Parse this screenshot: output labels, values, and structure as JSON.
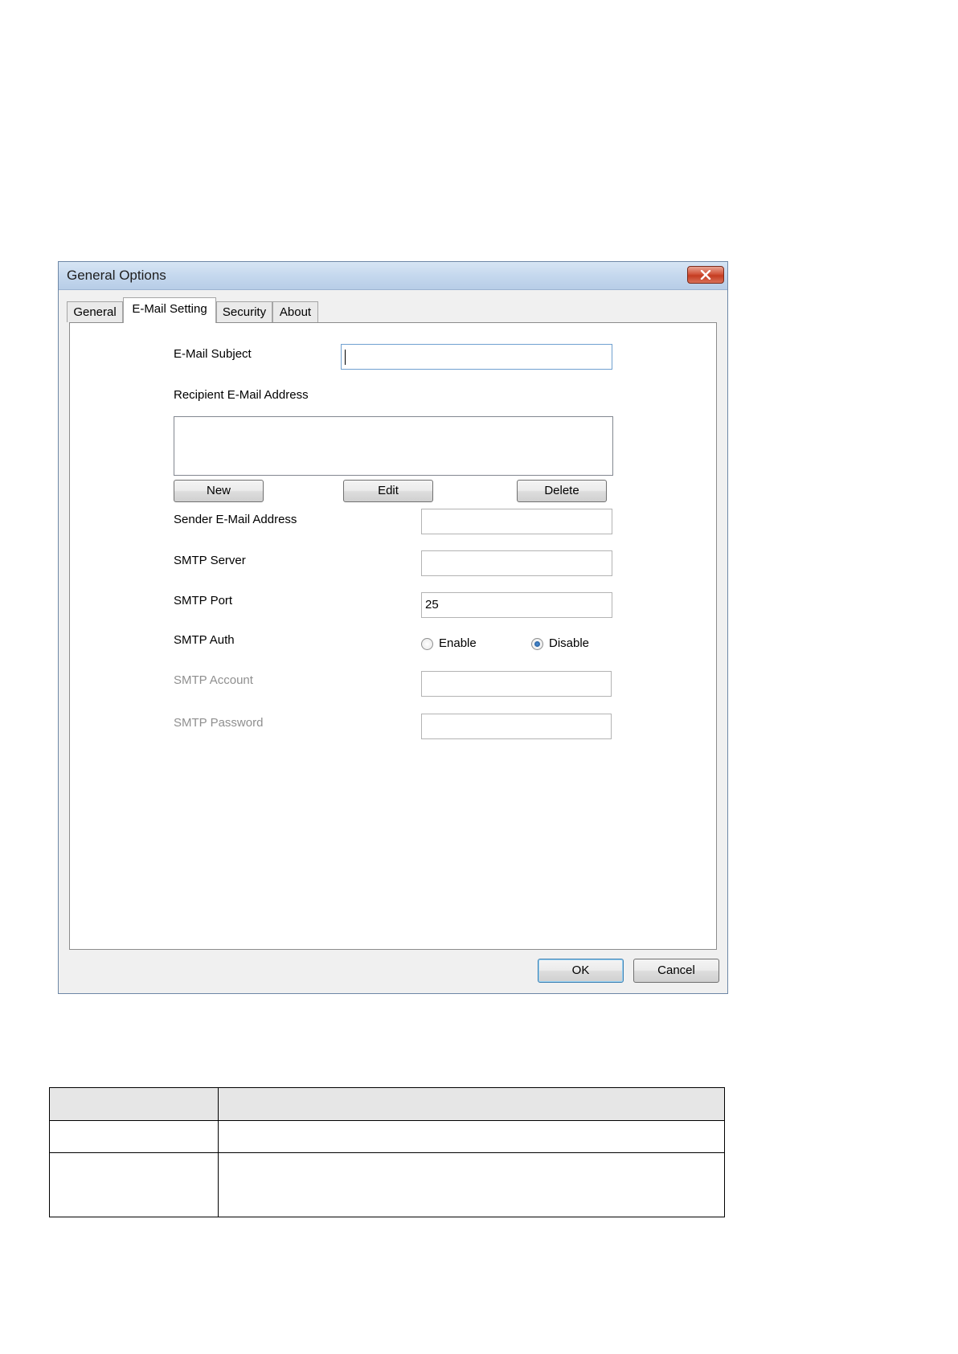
{
  "dialog": {
    "title": "General Options",
    "tabs": [
      {
        "label": "General",
        "active": false
      },
      {
        "label": "E-Mail Setting",
        "active": true
      },
      {
        "label": "Security",
        "active": false
      },
      {
        "label": "About",
        "active": false
      }
    ],
    "email_subject": {
      "label": "E-Mail Subject",
      "value": ""
    },
    "recipient": {
      "label": "Recipient E-Mail Address",
      "items": []
    },
    "buttons": {
      "new": "New",
      "edit": "Edit",
      "delete": "Delete"
    },
    "sender": {
      "label": "Sender E-Mail Address",
      "value": ""
    },
    "smtp_server": {
      "label": "SMTP Server",
      "value": ""
    },
    "smtp_port": {
      "label": "SMTP Port",
      "value": "25"
    },
    "smtp_auth": {
      "label": "SMTP Auth",
      "enable_label": "Enable",
      "disable_label": "Disable",
      "selected": "Disable"
    },
    "smtp_account": {
      "label": "SMTP Account",
      "value": "",
      "disabled": true
    },
    "smtp_password": {
      "label": "SMTP Password",
      "value": "",
      "disabled": true
    },
    "ok_label": "OK",
    "cancel_label": "Cancel"
  },
  "colors": {
    "titlebar": "#c5d8ee",
    "close_button": "#c43c21",
    "disabled_text": "#8f8f8f",
    "table_header": "#e6e6e6"
  }
}
